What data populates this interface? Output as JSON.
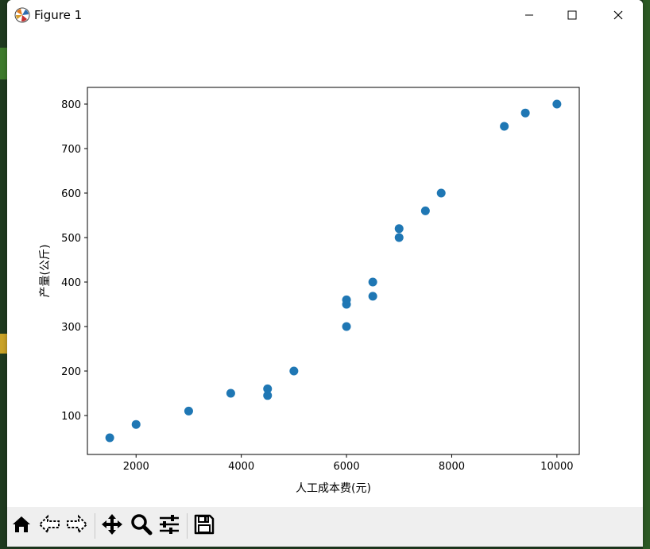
{
  "window": {
    "title": "Figure 1",
    "icons": {
      "app": "matplotlib-icon",
      "minimize": "minimize-icon",
      "maximize": "maximize-icon",
      "close": "close-icon"
    }
  },
  "toolbar": {
    "buttons": [
      {
        "name": "home-button",
        "icon": "home-icon"
      },
      {
        "name": "back-button",
        "icon": "back-arrow-icon"
      },
      {
        "name": "forward-button",
        "icon": "forward-arrow-icon"
      },
      {
        "name": "pan-button",
        "icon": "move-icon"
      },
      {
        "name": "zoom-button",
        "icon": "zoom-icon"
      },
      {
        "name": "configure-subplots-button",
        "icon": "sliders-icon"
      },
      {
        "name": "save-button",
        "icon": "save-icon"
      }
    ]
  },
  "chart_data": {
    "type": "scatter",
    "title": "",
    "xlabel": "人工成本费(元)",
    "ylabel": "产量(公斤)",
    "xlim": [
      1075,
      10425
    ],
    "ylim": [
      12.5,
      837.5
    ],
    "xticks": [
      2000,
      4000,
      6000,
      8000,
      10000
    ],
    "yticks": [
      100,
      200,
      300,
      400,
      500,
      600,
      700,
      800
    ],
    "grid": false,
    "marker_color": "#1f77b4",
    "x": [
      1500,
      2000,
      3000,
      3800,
      4500,
      4500,
      5000,
      6000,
      6000,
      6000,
      6500,
      6500,
      7000,
      7000,
      7500,
      7800,
      9000,
      9400,
      10000
    ],
    "y": [
      50,
      80,
      110,
      150,
      145,
      160,
      200,
      300,
      350,
      360,
      368,
      400,
      500,
      520,
      560,
      600,
      750,
      780,
      800
    ]
  }
}
